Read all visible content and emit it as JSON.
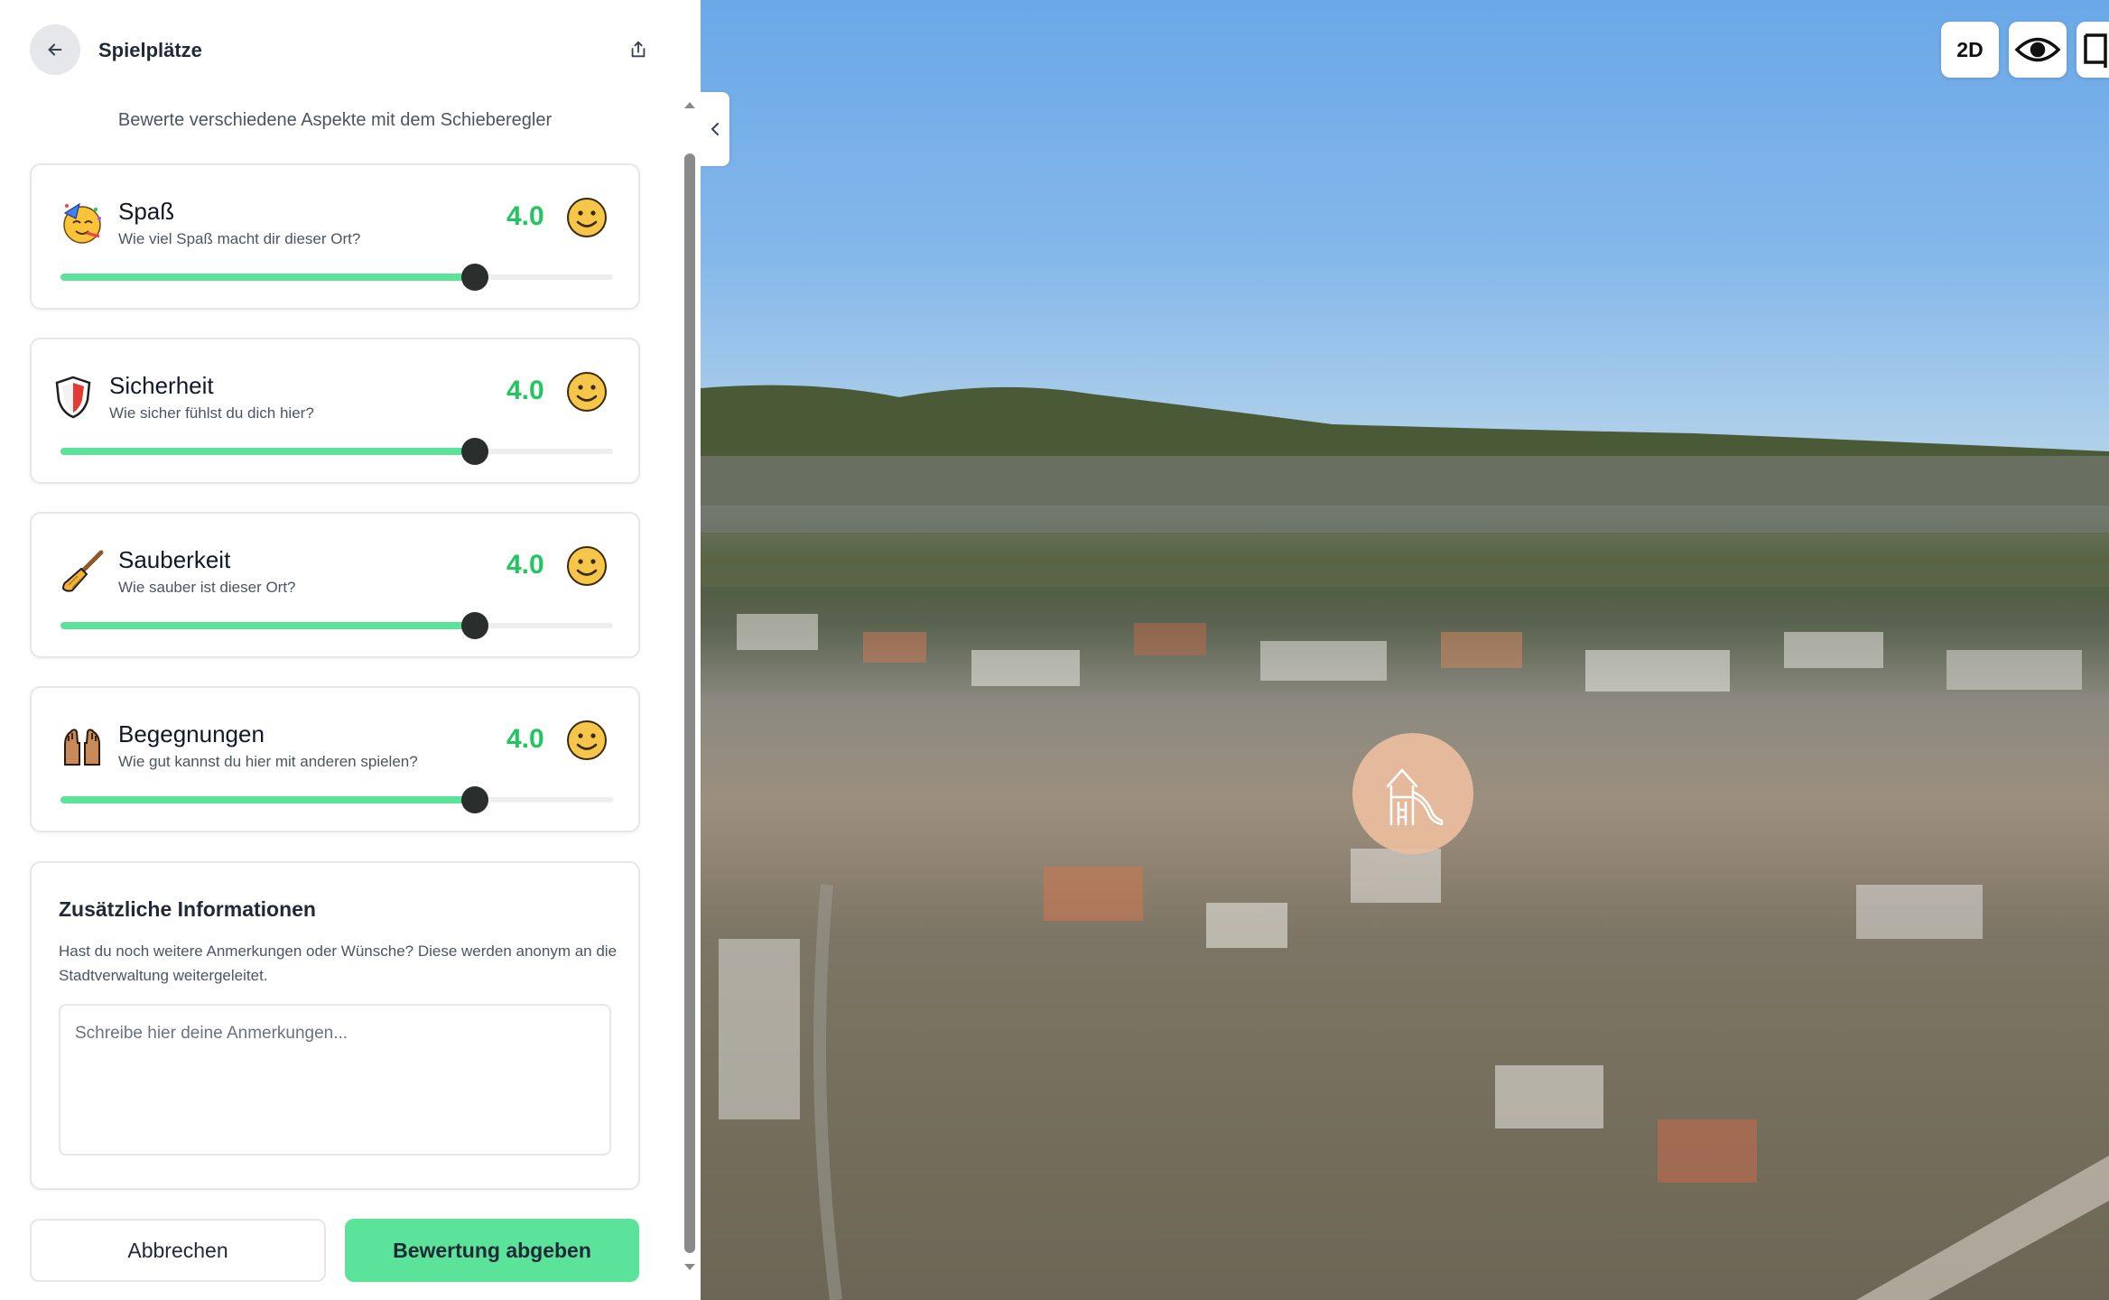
{
  "header": {
    "title": "Spielplätze",
    "subtitle": "Bewerte verschiedene Aspekte mit dem Schieberegler"
  },
  "ratings": [
    {
      "title": "Spaß",
      "question": "Wie viel Spaß macht dir dieser Ort?",
      "score": "4.0",
      "value": 0.75,
      "icon": "party-face-icon"
    },
    {
      "title": "Sicherheit",
      "question": "Wie sicher fühlst du dich hier?",
      "score": "4.0",
      "value": 0.75,
      "icon": "shield-icon"
    },
    {
      "title": "Sauberkeit",
      "question": "Wie sauber ist dieser Ort?",
      "score": "4.0",
      "value": 0.75,
      "icon": "broom-icon"
    },
    {
      "title": "Begegnungen",
      "question": "Wie gut kannst du hier mit anderen spielen?",
      "score": "4.0",
      "value": 0.75,
      "icon": "raised-hands-icon"
    }
  ],
  "info": {
    "title": "Zusätzliche Informationen",
    "text": "Hast du noch weitere Anmerkungen oder Wünsche? Diese werden anonym an die Stadtverwaltung weitergeleitet.",
    "placeholder": "Schreibe hier deine Anmerkungen..."
  },
  "buttons": {
    "cancel": "Abbrechen",
    "submit": "Bewertung abgeben"
  },
  "map": {
    "view_toggle": "2D",
    "marker_icon": "playground-icon",
    "colors": {
      "marker": "#ecbe9e",
      "accent": "#5be39a",
      "score": "#22c55e"
    }
  }
}
